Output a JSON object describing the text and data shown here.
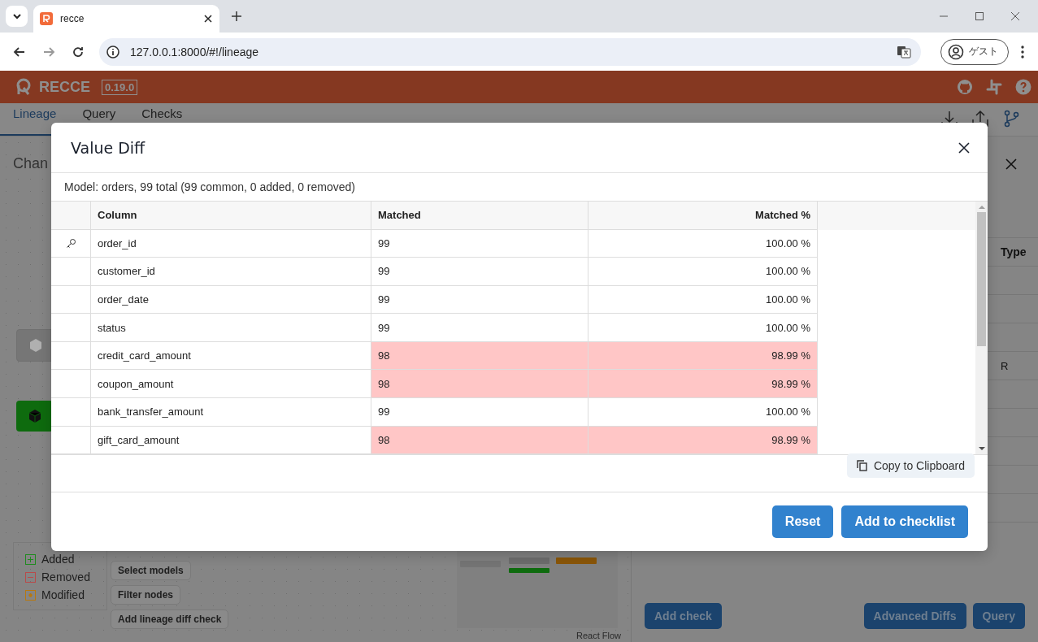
{
  "browser": {
    "tab_title": "recce",
    "url": "127.0.0.1:8000/#!/lineage",
    "profile": "ゲスト"
  },
  "app": {
    "logo": "RECCE",
    "version": "0.19.0",
    "nav_tabs": [
      {
        "label": "Lineage",
        "selected": true
      },
      {
        "label": "Query",
        "selected": false
      },
      {
        "label": "Checks",
        "selected": false
      }
    ],
    "canvas_title": "Chan",
    "legend": [
      {
        "label": "Added",
        "color": "#1f8a1f",
        "kind": "plus"
      },
      {
        "label": "Removed",
        "color": "#b84a4a",
        "kind": "minus"
      },
      {
        "label": "Modified",
        "color": "#b8780f",
        "kind": "dot"
      }
    ],
    "actions": [
      "Select models",
      "Filter nodes",
      "Add lineage diff check"
    ],
    "attribution": "React Flow",
    "panel_header": "Type",
    "panel_cell": "R",
    "panel_buttons": [
      "Add check",
      "Advanced Diffs",
      "Query"
    ]
  },
  "dialog": {
    "title": "Value Diff",
    "summary": "Model: orders, 99 total (99 common, 0 added, 0 removed)",
    "columns": [
      "Column",
      "Matched",
      "Matched %"
    ],
    "rows": [
      {
        "column": "order_id",
        "matched": "99",
        "percent": "100.00 %",
        "primary_key": true,
        "mismatch": false
      },
      {
        "column": "customer_id",
        "matched": "99",
        "percent": "100.00 %",
        "primary_key": false,
        "mismatch": false
      },
      {
        "column": "order_date",
        "matched": "99",
        "percent": "100.00 %",
        "primary_key": false,
        "mismatch": false
      },
      {
        "column": "status",
        "matched": "99",
        "percent": "100.00 %",
        "primary_key": false,
        "mismatch": false
      },
      {
        "column": "credit_card_amount",
        "matched": "98",
        "percent": "98.99 %",
        "primary_key": false,
        "mismatch": true
      },
      {
        "column": "coupon_amount",
        "matched": "98",
        "percent": "98.99 %",
        "primary_key": false,
        "mismatch": true
      },
      {
        "column": "bank_transfer_amount",
        "matched": "99",
        "percent": "100.00 %",
        "primary_key": false,
        "mismatch": false
      },
      {
        "column": "gift_card_amount",
        "matched": "98",
        "percent": "98.99 %",
        "primary_key": false,
        "mismatch": true
      }
    ],
    "copy_button": "Copy to Clipboard",
    "buttons": [
      "Reset",
      "Add to checklist"
    ]
  }
}
